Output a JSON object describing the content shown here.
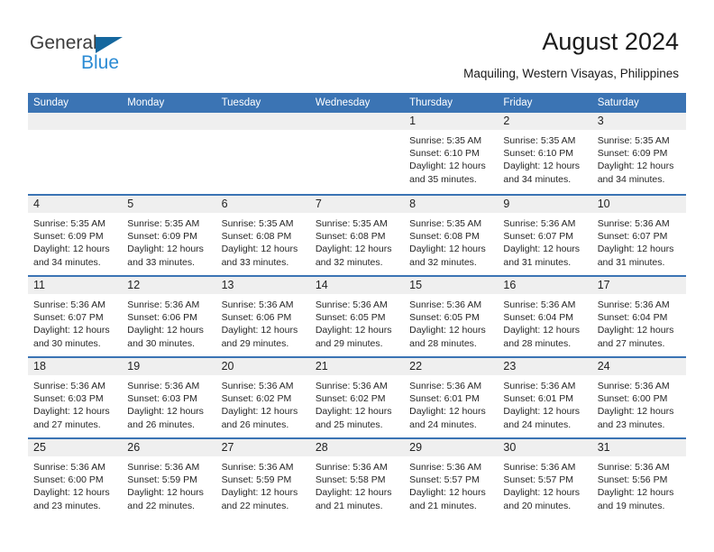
{
  "brand": {
    "name_part1": "General",
    "name_part2": "Blue",
    "colors": {
      "part1": "#3C3C3C",
      "part2": "#2B8BD4",
      "triangle": "#15679E"
    }
  },
  "header": {
    "title": "August 2024",
    "subtitle": "Maquiling, Western Visayas, Philippines"
  },
  "theme": {
    "header_blue": "#3B74B4",
    "row_divider": "#3B74B4",
    "day_band_gray": "#EFEFEF",
    "text": "#262626"
  },
  "weekdays": [
    "Sunday",
    "Monday",
    "Tuesday",
    "Wednesday",
    "Thursday",
    "Friday",
    "Saturday"
  ],
  "weeks": [
    [
      {
        "day": "",
        "sunrise": "",
        "sunset": "",
        "daylight1": "",
        "daylight2": ""
      },
      {
        "day": "",
        "sunrise": "",
        "sunset": "",
        "daylight1": "",
        "daylight2": ""
      },
      {
        "day": "",
        "sunrise": "",
        "sunset": "",
        "daylight1": "",
        "daylight2": ""
      },
      {
        "day": "",
        "sunrise": "",
        "sunset": "",
        "daylight1": "",
        "daylight2": ""
      },
      {
        "day": "1",
        "sunrise": "Sunrise: 5:35 AM",
        "sunset": "Sunset: 6:10 PM",
        "daylight1": "Daylight: 12 hours",
        "daylight2": "and 35 minutes."
      },
      {
        "day": "2",
        "sunrise": "Sunrise: 5:35 AM",
        "sunset": "Sunset: 6:10 PM",
        "daylight1": "Daylight: 12 hours",
        "daylight2": "and 34 minutes."
      },
      {
        "day": "3",
        "sunrise": "Sunrise: 5:35 AM",
        "sunset": "Sunset: 6:09 PM",
        "daylight1": "Daylight: 12 hours",
        "daylight2": "and 34 minutes."
      }
    ],
    [
      {
        "day": "4",
        "sunrise": "Sunrise: 5:35 AM",
        "sunset": "Sunset: 6:09 PM",
        "daylight1": "Daylight: 12 hours",
        "daylight2": "and 34 minutes."
      },
      {
        "day": "5",
        "sunrise": "Sunrise: 5:35 AM",
        "sunset": "Sunset: 6:09 PM",
        "daylight1": "Daylight: 12 hours",
        "daylight2": "and 33 minutes."
      },
      {
        "day": "6",
        "sunrise": "Sunrise: 5:35 AM",
        "sunset": "Sunset: 6:08 PM",
        "daylight1": "Daylight: 12 hours",
        "daylight2": "and 33 minutes."
      },
      {
        "day": "7",
        "sunrise": "Sunrise: 5:35 AM",
        "sunset": "Sunset: 6:08 PM",
        "daylight1": "Daylight: 12 hours",
        "daylight2": "and 32 minutes."
      },
      {
        "day": "8",
        "sunrise": "Sunrise: 5:35 AM",
        "sunset": "Sunset: 6:08 PM",
        "daylight1": "Daylight: 12 hours",
        "daylight2": "and 32 minutes."
      },
      {
        "day": "9",
        "sunrise": "Sunrise: 5:36 AM",
        "sunset": "Sunset: 6:07 PM",
        "daylight1": "Daylight: 12 hours",
        "daylight2": "and 31 minutes."
      },
      {
        "day": "10",
        "sunrise": "Sunrise: 5:36 AM",
        "sunset": "Sunset: 6:07 PM",
        "daylight1": "Daylight: 12 hours",
        "daylight2": "and 31 minutes."
      }
    ],
    [
      {
        "day": "11",
        "sunrise": "Sunrise: 5:36 AM",
        "sunset": "Sunset: 6:07 PM",
        "daylight1": "Daylight: 12 hours",
        "daylight2": "and 30 minutes."
      },
      {
        "day": "12",
        "sunrise": "Sunrise: 5:36 AM",
        "sunset": "Sunset: 6:06 PM",
        "daylight1": "Daylight: 12 hours",
        "daylight2": "and 30 minutes."
      },
      {
        "day": "13",
        "sunrise": "Sunrise: 5:36 AM",
        "sunset": "Sunset: 6:06 PM",
        "daylight1": "Daylight: 12 hours",
        "daylight2": "and 29 minutes."
      },
      {
        "day": "14",
        "sunrise": "Sunrise: 5:36 AM",
        "sunset": "Sunset: 6:05 PM",
        "daylight1": "Daylight: 12 hours",
        "daylight2": "and 29 minutes."
      },
      {
        "day": "15",
        "sunrise": "Sunrise: 5:36 AM",
        "sunset": "Sunset: 6:05 PM",
        "daylight1": "Daylight: 12 hours",
        "daylight2": "and 28 minutes."
      },
      {
        "day": "16",
        "sunrise": "Sunrise: 5:36 AM",
        "sunset": "Sunset: 6:04 PM",
        "daylight1": "Daylight: 12 hours",
        "daylight2": "and 28 minutes."
      },
      {
        "day": "17",
        "sunrise": "Sunrise: 5:36 AM",
        "sunset": "Sunset: 6:04 PM",
        "daylight1": "Daylight: 12 hours",
        "daylight2": "and 27 minutes."
      }
    ],
    [
      {
        "day": "18",
        "sunrise": "Sunrise: 5:36 AM",
        "sunset": "Sunset: 6:03 PM",
        "daylight1": "Daylight: 12 hours",
        "daylight2": "and 27 minutes."
      },
      {
        "day": "19",
        "sunrise": "Sunrise: 5:36 AM",
        "sunset": "Sunset: 6:03 PM",
        "daylight1": "Daylight: 12 hours",
        "daylight2": "and 26 minutes."
      },
      {
        "day": "20",
        "sunrise": "Sunrise: 5:36 AM",
        "sunset": "Sunset: 6:02 PM",
        "daylight1": "Daylight: 12 hours",
        "daylight2": "and 26 minutes."
      },
      {
        "day": "21",
        "sunrise": "Sunrise: 5:36 AM",
        "sunset": "Sunset: 6:02 PM",
        "daylight1": "Daylight: 12 hours",
        "daylight2": "and 25 minutes."
      },
      {
        "day": "22",
        "sunrise": "Sunrise: 5:36 AM",
        "sunset": "Sunset: 6:01 PM",
        "daylight1": "Daylight: 12 hours",
        "daylight2": "and 24 minutes."
      },
      {
        "day": "23",
        "sunrise": "Sunrise: 5:36 AM",
        "sunset": "Sunset: 6:01 PM",
        "daylight1": "Daylight: 12 hours",
        "daylight2": "and 24 minutes."
      },
      {
        "day": "24",
        "sunrise": "Sunrise: 5:36 AM",
        "sunset": "Sunset: 6:00 PM",
        "daylight1": "Daylight: 12 hours",
        "daylight2": "and 23 minutes."
      }
    ],
    [
      {
        "day": "25",
        "sunrise": "Sunrise: 5:36 AM",
        "sunset": "Sunset: 6:00 PM",
        "daylight1": "Daylight: 12 hours",
        "daylight2": "and 23 minutes."
      },
      {
        "day": "26",
        "sunrise": "Sunrise: 5:36 AM",
        "sunset": "Sunset: 5:59 PM",
        "daylight1": "Daylight: 12 hours",
        "daylight2": "and 22 minutes."
      },
      {
        "day": "27",
        "sunrise": "Sunrise: 5:36 AM",
        "sunset": "Sunset: 5:59 PM",
        "daylight1": "Daylight: 12 hours",
        "daylight2": "and 22 minutes."
      },
      {
        "day": "28",
        "sunrise": "Sunrise: 5:36 AM",
        "sunset": "Sunset: 5:58 PM",
        "daylight1": "Daylight: 12 hours",
        "daylight2": "and 21 minutes."
      },
      {
        "day": "29",
        "sunrise": "Sunrise: 5:36 AM",
        "sunset": "Sunset: 5:57 PM",
        "daylight1": "Daylight: 12 hours",
        "daylight2": "and 21 minutes."
      },
      {
        "day": "30",
        "sunrise": "Sunrise: 5:36 AM",
        "sunset": "Sunset: 5:57 PM",
        "daylight1": "Daylight: 12 hours",
        "daylight2": "and 20 minutes."
      },
      {
        "day": "31",
        "sunrise": "Sunrise: 5:36 AM",
        "sunset": "Sunset: 5:56 PM",
        "daylight1": "Daylight: 12 hours",
        "daylight2": "and 19 minutes."
      }
    ]
  ]
}
